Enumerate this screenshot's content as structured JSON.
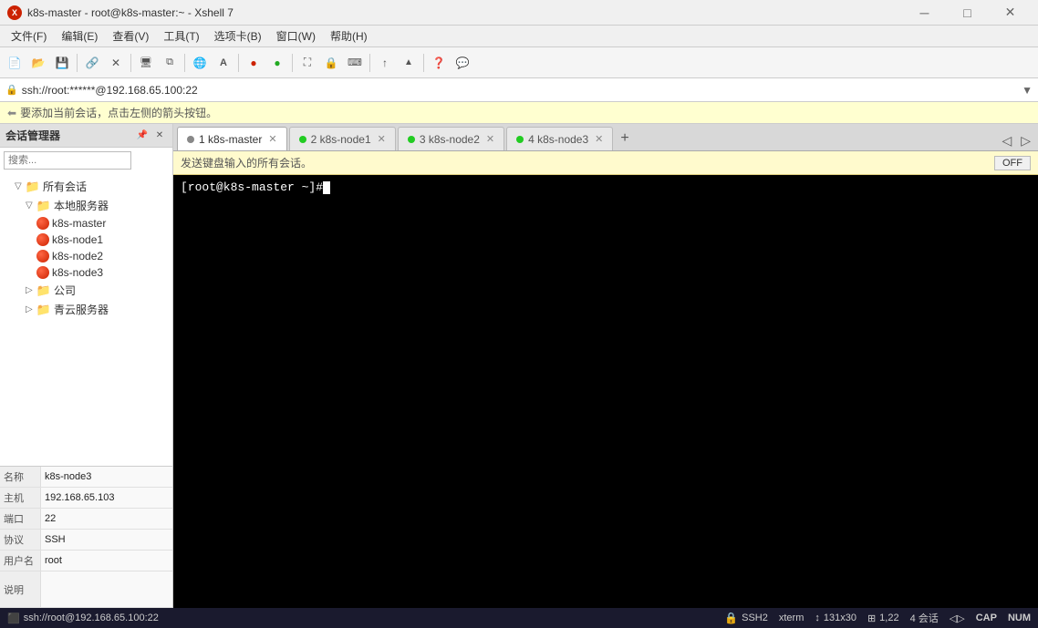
{
  "titleBar": {
    "title": "k8s-master - root@k8s-master:~ - Xshell 7",
    "iconColor": "#cc2200",
    "minLabel": "─",
    "maxLabel": "□",
    "closeLabel": "✕"
  },
  "menuBar": {
    "items": [
      "文件(F)",
      "编辑(E)",
      "查看(V)",
      "工具(T)",
      "选项卡(B)",
      "窗口(W)",
      "帮助(H)"
    ]
  },
  "addressBar": {
    "text": "ssh://root:******@192.168.65.100:22"
  },
  "infoBar": {
    "text": "要添加当前会话，点击左侧的箭头按钮。"
  },
  "sessionManager": {
    "title": "会话管理器"
  },
  "tree": {
    "items": [
      {
        "label": "所有会话",
        "level": 1,
        "type": "folder",
        "expanded": true
      },
      {
        "label": "本地服务器",
        "level": 2,
        "type": "folder",
        "expanded": true
      },
      {
        "label": "k8s-master",
        "level": 3,
        "type": "server",
        "selected": false
      },
      {
        "label": "k8s-node1",
        "level": 3,
        "type": "server",
        "selected": false
      },
      {
        "label": "k8s-node2",
        "level": 3,
        "type": "server",
        "selected": false
      },
      {
        "label": "k8s-node3",
        "level": 3,
        "type": "server",
        "selected": false
      },
      {
        "label": "公司",
        "level": 2,
        "type": "folder",
        "expanded": false
      },
      {
        "label": "青云服务器",
        "level": 2,
        "type": "folder",
        "expanded": false
      }
    ]
  },
  "sessionInfo": {
    "rows": [
      {
        "label": "名称",
        "value": "k8s-node3"
      },
      {
        "label": "主机",
        "value": "192.168.65.103"
      },
      {
        "label": "端口",
        "value": "22"
      },
      {
        "label": "协议",
        "value": "SSH"
      },
      {
        "label": "用户名",
        "value": "root"
      },
      {
        "label": "说明",
        "value": ""
      }
    ]
  },
  "tabs": [
    {
      "number": "1",
      "label": "k8s-master",
      "active": true,
      "dotColor": "gray"
    },
    {
      "number": "2",
      "label": "k8s-node1",
      "active": false,
      "dotColor": "green"
    },
    {
      "number": "3",
      "label": "k8s-node2",
      "active": false,
      "dotColor": "green"
    },
    {
      "number": "4",
      "label": "k8s-node3",
      "active": false,
      "dotColor": "green"
    }
  ],
  "notifBar": {
    "text": "发送键盘输入的所有会话。",
    "offLabel": "OFF"
  },
  "terminal": {
    "prompt": "[root@k8s-master ~]# "
  },
  "statusBar": {
    "address": "ssh://root@192.168.65.100:22",
    "protocol": "SSH2",
    "encoding": "xterm",
    "dimensions": "131x30",
    "position": "1,22",
    "sessions": "4 会话",
    "cap": "CAP",
    "num": "NUM"
  }
}
